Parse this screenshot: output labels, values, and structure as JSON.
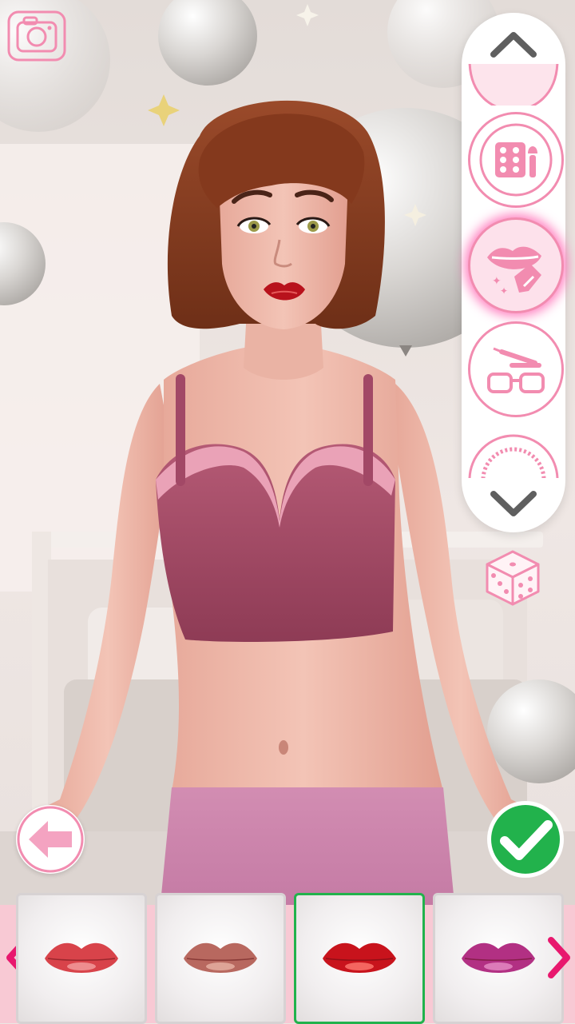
{
  "toolbar": {
    "camera_icon": "camera-icon",
    "randomize_icon": "dice-icon"
  },
  "categories": {
    "up_icon": "chevron-up-icon",
    "down_icon": "chevron-down-icon",
    "items": [
      {
        "name": "blush",
        "icon": "blush-icon",
        "selected": false
      },
      {
        "name": "eyeshadow",
        "icon": "eyeshadow-palette-icon",
        "selected": false
      },
      {
        "name": "lipstick",
        "icon": "lipstick-icon",
        "selected": true
      },
      {
        "name": "mascara",
        "icon": "mascara-glasses-icon",
        "selected": false
      },
      {
        "name": "accessory",
        "icon": "circle-accessory-icon",
        "selected": false
      }
    ]
  },
  "navigation": {
    "back_icon": "back-arrow-icon",
    "confirm_icon": "checkmark-icon",
    "prev_icon": "chevron-left-icon",
    "next_icon": "chevron-right-icon"
  },
  "lip_options": [
    {
      "color": "#d8434a",
      "highlight": "#f4a0a0",
      "selected": false
    },
    {
      "color": "#b8685f",
      "highlight": "#e7b3a5",
      "selected": false
    },
    {
      "color": "#c8131c",
      "highlight": "#ff7a72",
      "selected": true
    },
    {
      "color": "#b23083",
      "highlight": "#e68fc5",
      "selected": false
    }
  ],
  "colors": {
    "accent_pink": "#f28cb0",
    "confirm_green": "#22b24c",
    "tray_pink": "#f8c9d4",
    "magenta_arrow": "#e8186e"
  }
}
